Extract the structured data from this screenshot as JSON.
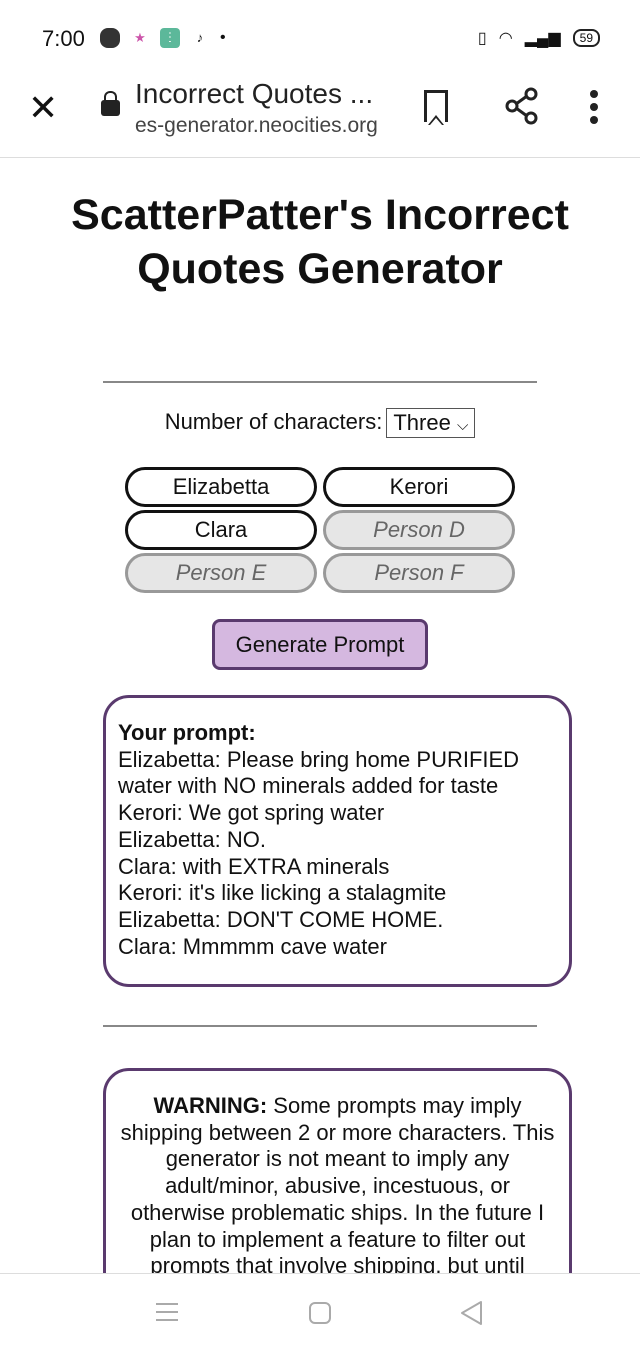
{
  "status": {
    "time": "7:00",
    "battery": "59"
  },
  "browser": {
    "title": "Incorrect Quotes ...",
    "url": "es-generator.neocities.org"
  },
  "page": {
    "title": "ScatterPatter's Incorrect Quotes Generator",
    "num_label": "Number of characters:",
    "num_value": "Three",
    "characters": [
      {
        "value": "Elizabetta",
        "enabled": true
      },
      {
        "value": "Kerori",
        "enabled": true
      },
      {
        "value": "Clara",
        "enabled": true
      },
      {
        "value": "Person D",
        "enabled": false
      },
      {
        "value": "Person E",
        "enabled": false
      },
      {
        "value": "Person F",
        "enabled": false
      }
    ],
    "generate_label": "Generate Prompt",
    "prompt_heading": "Your prompt:",
    "prompt_lines": [
      "Elizabetta: Please bring home PURIFIED water with NO minerals added for taste",
      "Kerori: We got spring water",
      "Elizabetta: NO.",
      "Clara: with EXTRA minerals",
      "Kerori: it's like licking a stalagmite",
      "Elizabetta: DON'T COME HOME.",
      "Clara: Mmmmm cave water"
    ],
    "warning_label": "WARNING:",
    "warning_text": "Some prompts may imply shipping between 2 or more characters. This generator is not meant to imply any adult/minor, abusive, incestuous, or otherwise problematic ships. In the future I plan to implement a feature to filter out prompts that involve shipping, but until"
  },
  "colors": {
    "accent": "#5a3a6e",
    "button_bg": "#d5b8e0"
  }
}
